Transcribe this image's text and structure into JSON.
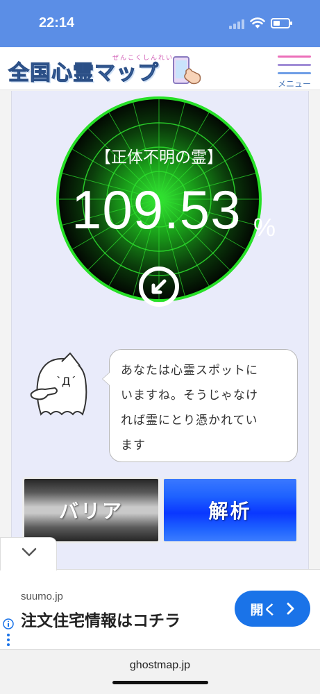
{
  "status_bar": {
    "time": "22:14"
  },
  "header": {
    "logo": "全国心霊マップ",
    "logo_sub": "ぜんこくしんれい",
    "menu_label": "メニュー"
  },
  "radar": {
    "title": "【正体不明の霊】",
    "value": "109.53",
    "unit": "%"
  },
  "bubble": {
    "lines": [
      "あなたは心霊スポットに",
      "いますね。そうじゃなけ",
      "れば霊にとり憑かれてい",
      "ます"
    ]
  },
  "buttons": {
    "barrier": "バリア",
    "analyze": "解析"
  },
  "ad": {
    "source": "suumo.jp",
    "headline": "注文住宅情報はコチラ",
    "button": "開く"
  },
  "browser": {
    "url": "ghostmap.jp"
  },
  "colors": {
    "status_bar": "#5b8ee6",
    "radar_green": "#1fd81f",
    "panel": "#e9ebfa",
    "analyze_blue": "#1a52ff",
    "ad_button": "#1a73e8"
  },
  "icons": [
    "signal-icon",
    "wifi-icon",
    "battery-icon",
    "phone-hand-icon",
    "hamburger-menu-icon",
    "direction-arrow-icon",
    "ghost-character",
    "chevron-down-icon",
    "chevron-right-icon",
    "info-icon"
  ]
}
